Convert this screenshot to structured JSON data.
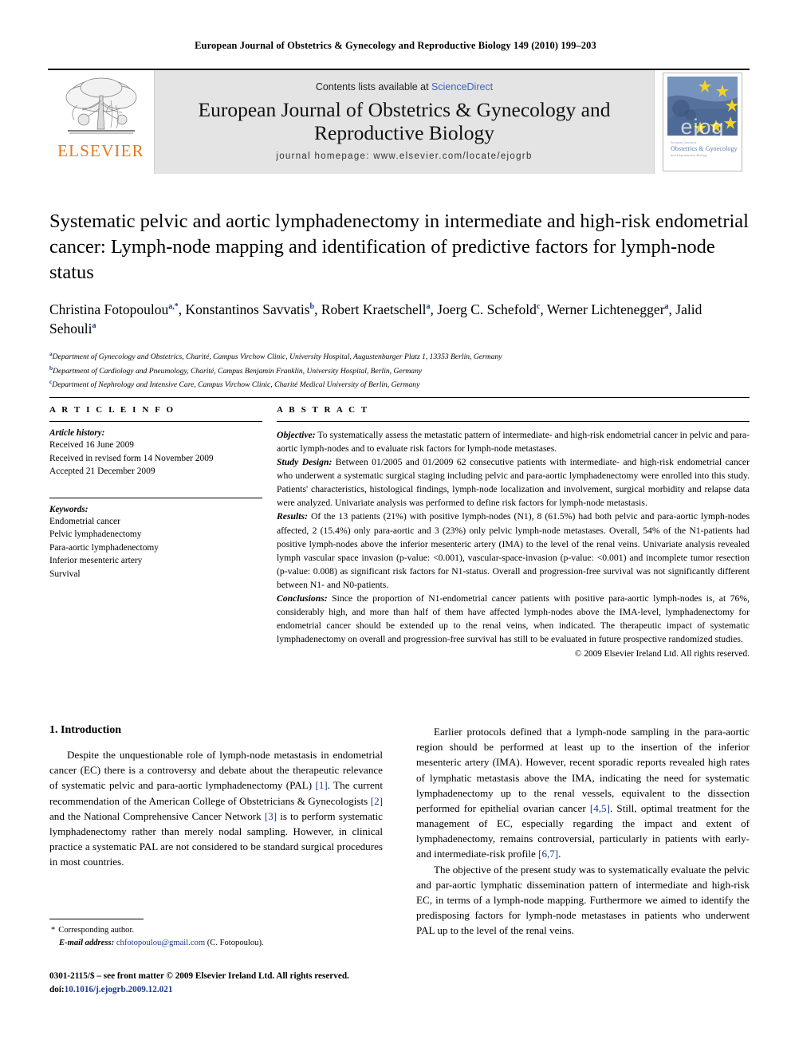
{
  "running_head": "European Journal of Obstetrics & Gynecology and Reproductive Biology 149 (2010) 199–203",
  "masthead": {
    "publisher": "ELSEVIER",
    "contents_prefix": "Contents lists available at ",
    "sciencedirect": "ScienceDirect",
    "journal_title": "European Journal of Obstetrics & Gynecology and Reproductive Biology",
    "homepage": "journal homepage: www.elsevier.com/locate/ejogrb",
    "cover": {
      "watermark": "ejog",
      "small_top": "European Journal of",
      "line1": "Obstetrics & Gynecology",
      "line2": "and Reproductive Biology"
    },
    "colors": {
      "band": "#e4e4e4",
      "elsevier_orange": "#E87722",
      "link_blue": "#3f5fbf"
    }
  },
  "article": {
    "title": "Systematic pelvic and aortic lymphadenectomy in intermediate and high-risk endometrial cancer: Lymph-node mapping and identification of predictive factors for lymph-node status",
    "authors": [
      {
        "name": "Christina Fotopoulou",
        "marks": "a,*"
      },
      {
        "name": "Konstantinos Savvatis",
        "marks": "b"
      },
      {
        "name": "Robert Kraetschell",
        "marks": "a"
      },
      {
        "name": "Joerg C. Schefold",
        "marks": "c"
      },
      {
        "name": "Werner Lichtenegger",
        "marks": "a"
      },
      {
        "name": "Jalid Sehouli",
        "marks": "a"
      }
    ],
    "affiliations": [
      {
        "mark": "a",
        "text": "Department of Gynecology and Obstetrics, Charité, Campus Virchow Clinic, University Hospital, Augustenburger Platz 1, 13353 Berlin, Germany"
      },
      {
        "mark": "b",
        "text": "Department of Cardiology and Pneumology, Charité, Campus Benjamin Franklin, University Hospital, Berlin, Germany"
      },
      {
        "mark": "c",
        "text": "Department of Nephrology and Intensive Care, Campus Virchow Clinic, Charité Medical University of Berlin, Germany"
      }
    ]
  },
  "article_info": {
    "heading": "A R T I C L E   I N F O",
    "history_label": "Article history:",
    "history": [
      "Received 16 June 2009",
      "Received in revised form 14 November 2009",
      "Accepted 21 December 2009"
    ],
    "keywords_label": "Keywords:",
    "keywords": [
      "Endometrial cancer",
      "Pelvic lymphadenectomy",
      "Para-aortic lymphadenectomy",
      "Inferior mesenteric artery",
      "Survival"
    ]
  },
  "abstract": {
    "heading": "A B S T R A C T",
    "sections": [
      {
        "label": "Objective:",
        "text": " To systematically assess the metastatic pattern of intermediate- and high-risk endometrial cancer in pelvic and para-aortic lymph-nodes and to evaluate risk factors for lymph-node metastases."
      },
      {
        "label": "Study Design:",
        "text": " Between 01/2005 and 01/2009 62 consecutive patients with intermediate- and high-risk endometrial cancer who underwent a systematic surgical staging including pelvic and para-aortic lymphadenectomy were enrolled into this study. Patients' characteristics, histological findings, lymph-node localization and involvement, surgical morbidity and relapse data were analyzed. Univariate analysis was performed to define risk factors for lymph-node metastasis."
      },
      {
        "label": "Results:",
        "text": " Of the 13 patients (21%) with positive lymph-nodes (N1), 8 (61.5%) had both pelvic and para-aortic lymph-nodes affected, 2 (15.4%) only para-aortic and 3 (23%) only pelvic lymph-node metastases. Overall, 54% of the N1-patients had positive lymph-nodes above the inferior mesenteric artery (IMA) to the level of the renal veins. Univariate analysis revealed lymph vascular space invasion (p-value: <0.001), vascular-space-invasion (p-value: <0.001) and incomplete tumor resection (p-value: 0.008) as significant risk factors for N1-status. Overall and progression-free survival was not significantly different between N1- and N0-patients."
      },
      {
        "label": "Conclusions:",
        "text": " Since the proportion of N1-endometrial cancer patients with positive para-aortic lymph-nodes is, at 76%, considerably high, and more than half of them have affected lymph-nodes above the IMA-level, lymphadenectomy for endometrial cancer should be extended up to the renal veins, when indicated. The therapeutic impact of systematic lymphadenectomy on overall and progression-free survival has still to be evaluated in future prospective randomized studies."
      }
    ],
    "copyright": "© 2009 Elsevier Ireland Ltd. All rights reserved."
  },
  "body": {
    "section_heading": "1. Introduction",
    "left_paragraphs": [
      "Despite the unquestionable role of lymph-node metastasis in endometrial cancer (EC) there is a controversy and debate about the therapeutic relevance of systematic pelvic and para-aortic lymphadenectomy (PAL) [1]. The current recommendation of the American College of Obstetricians & Gynecologists [2] and the National Comprehensive Cancer Network [3] is to perform systematic lymphadenectomy rather than merely nodal sampling. However, in clinical practice a systematic PAL are not considered to be standard surgical procedures in most countries."
    ],
    "right_paragraphs": [
      "Earlier protocols defined that a lymph-node sampling in the para-aortic region should be performed at least up to the insertion of the inferior mesenteric artery (IMA). However, recent sporadic reports revealed high rates of lymphatic metastasis above the IMA, indicating the need for systematic lymphadenectomy up to the renal vessels, equivalent to the dissection performed for epithelial ovarian cancer [4,5]. Still, optimal treatment for the management of EC, especially regarding the impact and extent of lymphadenectomy, remains controversial, particularly in patients with early- and intermediate-risk profile [6,7].",
      "The objective of the present study was to systematically evaluate the pelvic and par-aortic lymphatic dissemination pattern of intermediate and high-risk EC, in terms of a lymph-node mapping. Furthermore we aimed to identify the predisposing factors for lymph-node metastases in patients who underwent PAL up to the level of the renal veins."
    ]
  },
  "footnote": {
    "corresponding": "Corresponding author.",
    "email_label": "E-mail address:",
    "email": "chfotopoulou@gmail.com",
    "email_suffix": " (C. Fotopoulou)."
  },
  "imprint": {
    "line1": "0301-2115/$ – see front matter © 2009 Elsevier Ireland Ltd. All rights reserved.",
    "doi_label": "doi:",
    "doi": "10.1016/j.ejogrb.2009.12.021"
  }
}
